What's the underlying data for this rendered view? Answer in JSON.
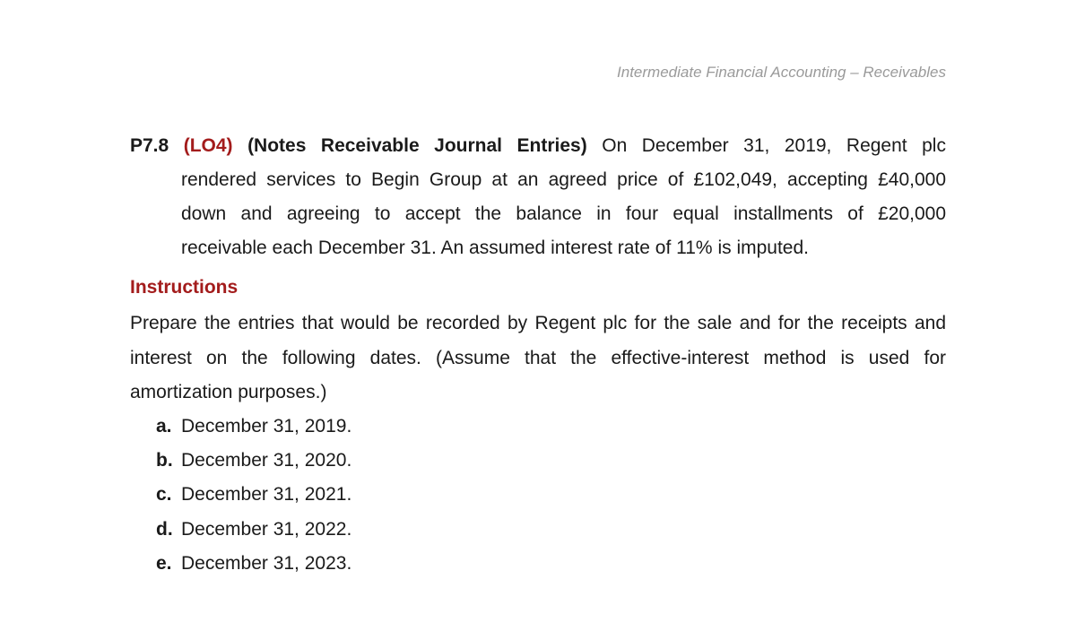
{
  "header": {
    "running_title": "Intermediate Financial Accounting – Receivables"
  },
  "problem": {
    "number": "P7.8",
    "learning_objective": "(LO4)",
    "title": "(Notes Receivable Journal Entries)",
    "lines": [
      "On December 31, 2019, Regent plc",
      "rendered services to Begin Group at an agreed price of £102,049, accepting £40,000",
      "down and agreeing to accept the balance in four equal installments of £20,000",
      "receivable each December 31. An assumed interest rate of 11% is imputed."
    ]
  },
  "instructions": {
    "heading": "Instructions",
    "lines": [
      "Prepare the entries that would be recorded by Regent plc for the sale and for the receipts and",
      "interest on the following dates. (Assume that the effective-interest method is used for",
      "amortization purposes.)"
    ],
    "items": [
      {
        "marker": "a.",
        "text": "December 31, 2019."
      },
      {
        "marker": "b.",
        "text": "December 31, 2020."
      },
      {
        "marker": "c.",
        "text": "December 31, 2021."
      },
      {
        "marker": "d.",
        "text": "December 31, 2022."
      },
      {
        "marker": "e.",
        "text": "December 31, 2023."
      }
    ]
  },
  "colors": {
    "accent": "#a31c1c",
    "header_gray": "#9a9a9a",
    "text": "#1a1a1a"
  }
}
